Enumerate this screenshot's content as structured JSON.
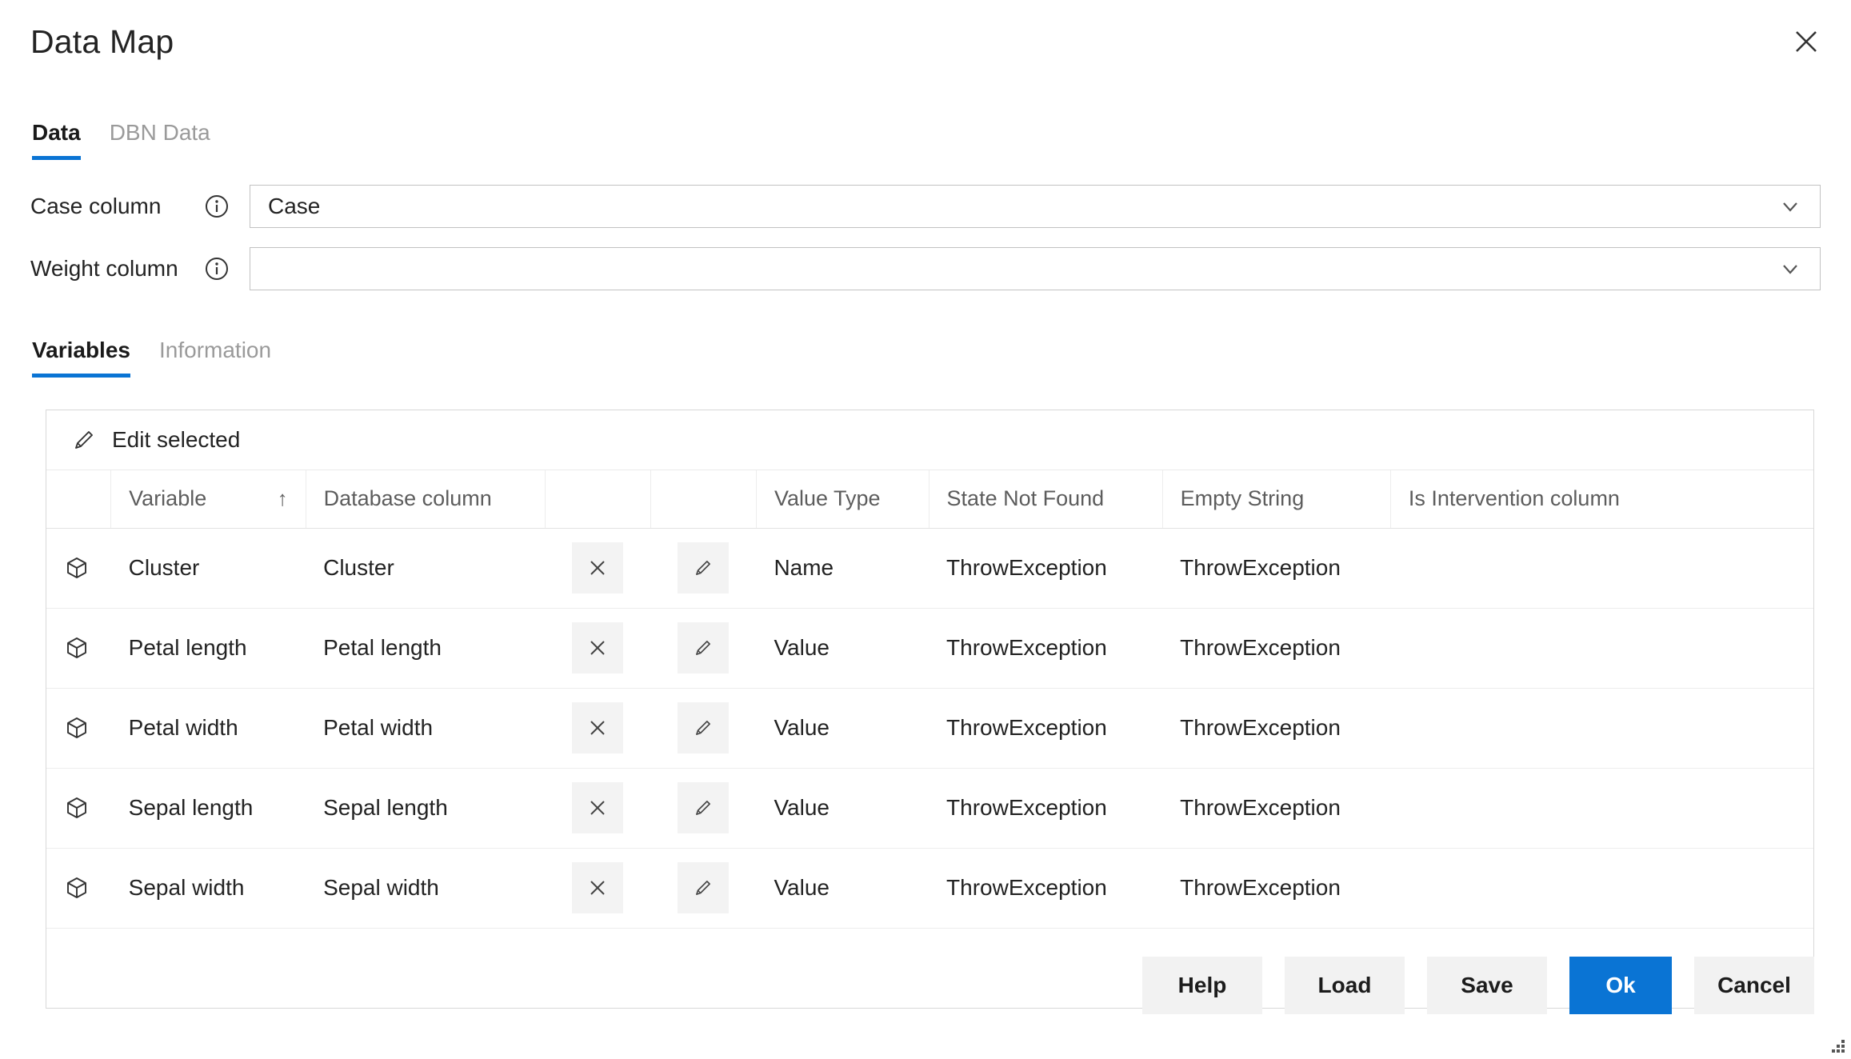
{
  "window": {
    "title": "Data Map",
    "close_icon": "close-icon",
    "resize_grip_icon": "resize-grip-icon"
  },
  "top_tabs": [
    {
      "label": "Data",
      "active": true
    },
    {
      "label": "DBN Data",
      "active": false
    }
  ],
  "form": {
    "case_column": {
      "label": "Case column",
      "info_icon": "info-icon",
      "value": "Case",
      "placeholder": "",
      "chevron_icon": "chevron-down-icon"
    },
    "weight_column": {
      "label": "Weight column",
      "info_icon": "info-icon",
      "value": "",
      "placeholder": "",
      "chevron_icon": "chevron-down-icon"
    }
  },
  "sub_tabs": [
    {
      "label": "Variables",
      "active": true
    },
    {
      "label": "Information",
      "active": false
    }
  ],
  "table": {
    "toolbar": {
      "edit_selected_label": "Edit selected",
      "edit_selected_icon": "pencil-icon"
    },
    "columns": [
      {
        "key": "icon",
        "label": ""
      },
      {
        "key": "variable",
        "label": "Variable",
        "sort_indicator": "↑"
      },
      {
        "key": "database_column",
        "label": "Database column"
      },
      {
        "key": "remove",
        "label": ""
      },
      {
        "key": "edit",
        "label": ""
      },
      {
        "key": "value_type",
        "label": "Value Type"
      },
      {
        "key": "state_not_found",
        "label": "State Not Found"
      },
      {
        "key": "empty_string",
        "label": "Empty String"
      },
      {
        "key": "is_intervention_column",
        "label": "Is Intervention column"
      }
    ],
    "row_icon": "cube-icon",
    "remove_icon": "close-icon",
    "edit_icon": "pencil-icon",
    "rows": [
      {
        "variable": "Cluster",
        "database_column": "Cluster",
        "value_type": "Name",
        "state_not_found": "ThrowException",
        "empty_string": "ThrowException",
        "is_intervention_column": ""
      },
      {
        "variable": "Petal length",
        "database_column": "Petal length",
        "value_type": "Value",
        "state_not_found": "ThrowException",
        "empty_string": "ThrowException",
        "is_intervention_column": ""
      },
      {
        "variable": "Petal width",
        "database_column": "Petal width",
        "value_type": "Value",
        "state_not_found": "ThrowException",
        "empty_string": "ThrowException",
        "is_intervention_column": ""
      },
      {
        "variable": "Sepal length",
        "database_column": "Sepal length",
        "value_type": "Value",
        "state_not_found": "ThrowException",
        "empty_string": "ThrowException",
        "is_intervention_column": ""
      },
      {
        "variable": "Sepal width",
        "database_column": "Sepal width",
        "value_type": "Value",
        "state_not_found": "ThrowException",
        "empty_string": "ThrowException",
        "is_intervention_column": ""
      }
    ]
  },
  "footer": {
    "help_label": "Help",
    "load_label": "Load",
    "save_label": "Save",
    "ok_label": "Ok",
    "cancel_label": "Cancel"
  },
  "colors": {
    "accent": "#0a74d4",
    "text": "#232323",
    "muted_text": "#9a9a9a",
    "header_text": "#5d5d5d",
    "border": "#c2c2c2",
    "grid_border": "#ededed",
    "button_bg": "#f2f2f2",
    "icon_button_bg": "#f3f3f3"
  }
}
